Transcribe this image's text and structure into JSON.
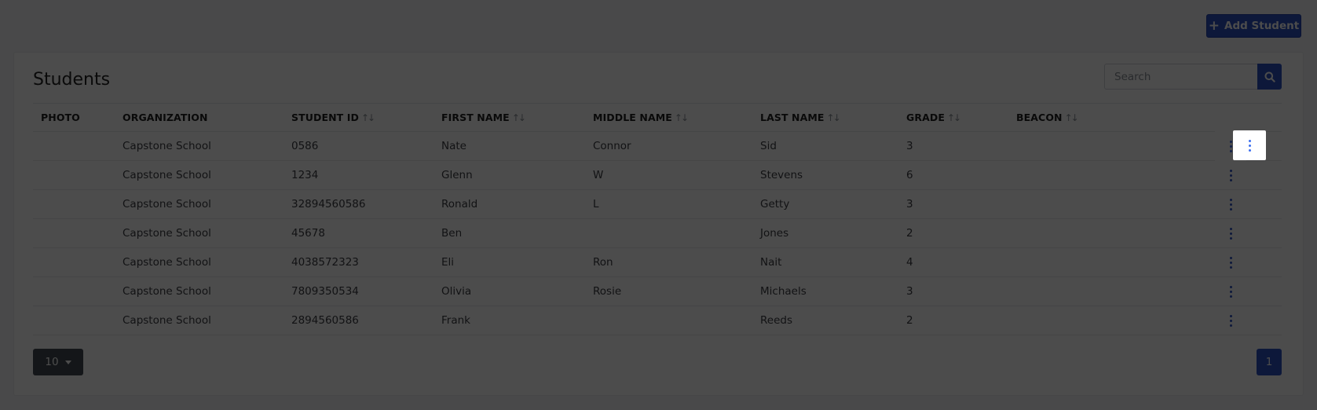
{
  "toolbar": {
    "add_student_label": "Add Student"
  },
  "page": {
    "title": "Students"
  },
  "search": {
    "placeholder": "Search",
    "value": ""
  },
  "table": {
    "columns": {
      "photo": "PHOTO",
      "organization": "ORGANIZATION",
      "student_id": "STUDENT ID",
      "first_name": "FIRST NAME",
      "middle_name": "MIDDLE NAME",
      "last_name": "LAST NAME",
      "grade": "GRADE",
      "beacon": "BEACON"
    },
    "sort_glyph": "↑↓",
    "rows": [
      {
        "organization": "Capstone School",
        "student_id": "0586",
        "first_name": "Nate",
        "middle_name": "Connor",
        "last_name": "Sid",
        "grade": "3",
        "beacon": ""
      },
      {
        "organization": "Capstone School",
        "student_id": "1234",
        "first_name": "Glenn",
        "middle_name": "W",
        "last_name": "Stevens",
        "grade": "6",
        "beacon": ""
      },
      {
        "organization": "Capstone School",
        "student_id": "32894560586",
        "first_name": "Ronald",
        "middle_name": "L",
        "last_name": "Getty",
        "grade": "3",
        "beacon": ""
      },
      {
        "organization": "Capstone School",
        "student_id": "45678",
        "first_name": "Ben",
        "middle_name": "",
        "last_name": "Jones",
        "grade": "2",
        "beacon": ""
      },
      {
        "organization": "Capstone School",
        "student_id": "4038572323",
        "first_name": "Eli",
        "middle_name": "Ron",
        "last_name": "Nait",
        "grade": "4",
        "beacon": ""
      },
      {
        "organization": "Capstone School",
        "student_id": "7809350534",
        "first_name": "Olivia",
        "middle_name": "Rosie",
        "last_name": "Michaels",
        "grade": "3",
        "beacon": ""
      },
      {
        "organization": "Capstone School",
        "student_id": "2894560586",
        "first_name": "Frank",
        "middle_name": "",
        "last_name": "Reeds",
        "grade": "2",
        "beacon": ""
      }
    ]
  },
  "pagination": {
    "page_size": "10",
    "current_page": "1"
  },
  "colors": {
    "accent": "#2d52c4",
    "overlay": "rgba(0,0,0,0.70)"
  },
  "icons": {
    "add": "plus-icon",
    "search": "search-icon",
    "row_actions": "more-vertical-icon",
    "page_size": "caret-down-icon"
  }
}
